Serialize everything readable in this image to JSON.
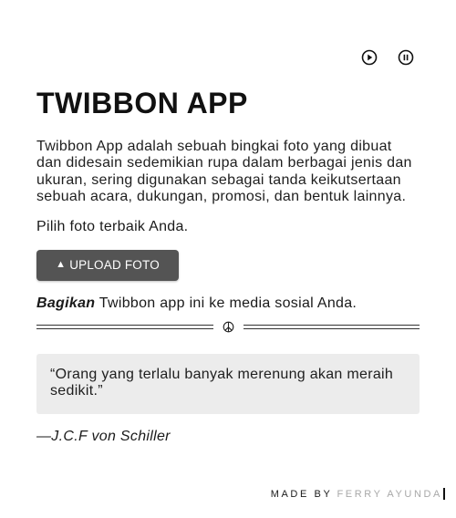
{
  "media_controls": {
    "play_icon": "play-circle-icon",
    "pause_icon": "pause-circle-icon"
  },
  "app": {
    "title": "TWIBBON APP",
    "description": "Twibbon App adalah sebuah bingkai foto yang dibuat dan didesain sedemikian rupa dalam berbagai jenis dan ukuran, sering digunakan sebagai tanda keikutsertaan sebuah acara, dukungan, promosi, dan bentuk lainnya.",
    "prompt": "Pilih foto terbaik Anda.",
    "upload_icon": "▲",
    "upload_label": "UPLOAD FOTO",
    "share_bold": "Bagikan",
    "share_rest": " Twibbon app ini ke media sosial Anda."
  },
  "divider_icon": "peace-icon",
  "quote": {
    "text": "“Orang yang terlalu banyak merenung akan meraih sedikit.”",
    "author": "—J.C.F von Schiller"
  },
  "footer": {
    "made_by": "MADE BY",
    "author_name": "FERRY AYUNDA"
  },
  "colors": {
    "button_bg": "#545454",
    "quote_bg": "#ececec",
    "footer_name": "#a8a8a8"
  }
}
